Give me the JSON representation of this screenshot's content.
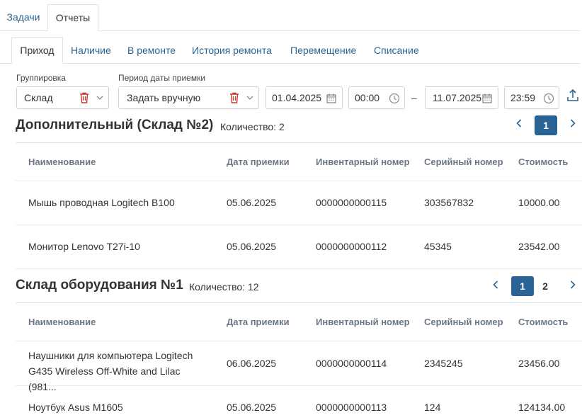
{
  "top_tabs": [
    {
      "label": "Задачи"
    },
    {
      "label": "Отчеты"
    }
  ],
  "sub_tabs": [
    {
      "label": "Приход"
    },
    {
      "label": "Наличие"
    },
    {
      "label": "В ремонте"
    },
    {
      "label": "История ремонта"
    },
    {
      "label": "Перемещение"
    },
    {
      "label": "Списание"
    }
  ],
  "filters": {
    "grouping_label": "Группировка",
    "grouping_value": "Склад",
    "period_label": "Период даты приемки",
    "period_value": "Задать вручную",
    "date_from": "01.04.2025",
    "time_from": "00:00",
    "dash": "–",
    "date_to": "11.07.2025",
    "time_to": "23:59"
  },
  "columns": [
    "Наименование",
    "Дата приемки",
    "Инвентарный номер",
    "Серийный номер",
    "Стоимость"
  ],
  "sections": [
    {
      "title": "Дополнительный (Склад №2)",
      "count": "Количество: 2",
      "pages": [
        "1"
      ],
      "rows": [
        [
          "Мышь проводная Logitech B100",
          "05.06.2025",
          "0000000000115",
          "303567832",
          "10000.00"
        ],
        [
          "Монитор Lenovo T27i-10",
          "05.06.2025",
          "0000000000112",
          "45345",
          "23542.00"
        ]
      ]
    },
    {
      "title": "Склад оборудования №1",
      "count": "Количество: 12",
      "pages": [
        "1",
        "2"
      ],
      "rows": [
        [
          "Наушники для компьютера Logitech G435 Wireless Off-White and Lilac (981...",
          "06.06.2025",
          "0000000000114",
          "2345245",
          "23456.00"
        ],
        [
          "Ноутбук Asus M1605",
          "05.06.2025",
          "0000000000113",
          "124",
          "124134.00"
        ]
      ]
    }
  ],
  "colors": {
    "accent": "#2a6496",
    "trash": "#c0392b"
  },
  "icons": [
    "trash-icon",
    "chevron-down-icon",
    "calendar-icon",
    "clock-icon",
    "export-icon",
    "chevron-left-icon",
    "chevron-right-icon"
  ]
}
